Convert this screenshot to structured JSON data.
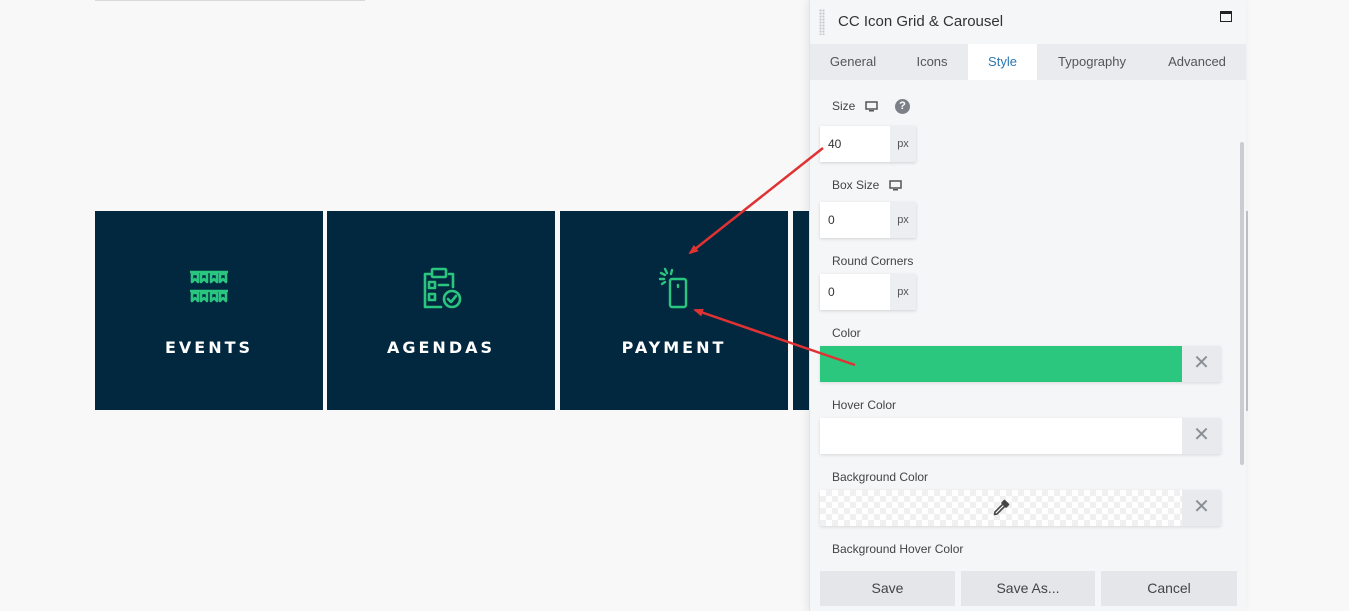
{
  "canvas": {
    "tiles": [
      {
        "label": "EVENTS",
        "icon": "bunting-flags-icon"
      },
      {
        "label": "AGENDAS",
        "icon": "clipboard-check-icon"
      },
      {
        "label": "PAYMENT",
        "icon": "phone-tap-icon"
      }
    ],
    "tile_background": "#022840",
    "icon_color": "#2ac57f"
  },
  "panel": {
    "title": "CC Icon Grid & Carousel",
    "tabs": [
      {
        "label": "General"
      },
      {
        "label": "Icons"
      },
      {
        "label": "Style"
      },
      {
        "label": "Typography"
      },
      {
        "label": "Advanced"
      }
    ],
    "active_tab": "Style",
    "fields": {
      "size": {
        "label": "Size",
        "value": "40",
        "unit": "px"
      },
      "box_size": {
        "label": "Box Size",
        "value": "0",
        "unit": "px"
      },
      "round_corners": {
        "label": "Round Corners",
        "value": "0",
        "unit": "px"
      },
      "color": {
        "label": "Color",
        "value": "#2bc77f"
      },
      "hover_color": {
        "label": "Hover Color",
        "value": "#ffffff"
      },
      "background_color": {
        "label": "Background Color"
      },
      "background_hover_color": {
        "label": "Background Hover Color"
      }
    },
    "buttons": {
      "save": "Save",
      "save_as": "Save As...",
      "cancel": "Cancel"
    }
  },
  "annotation_color": "#e03232"
}
